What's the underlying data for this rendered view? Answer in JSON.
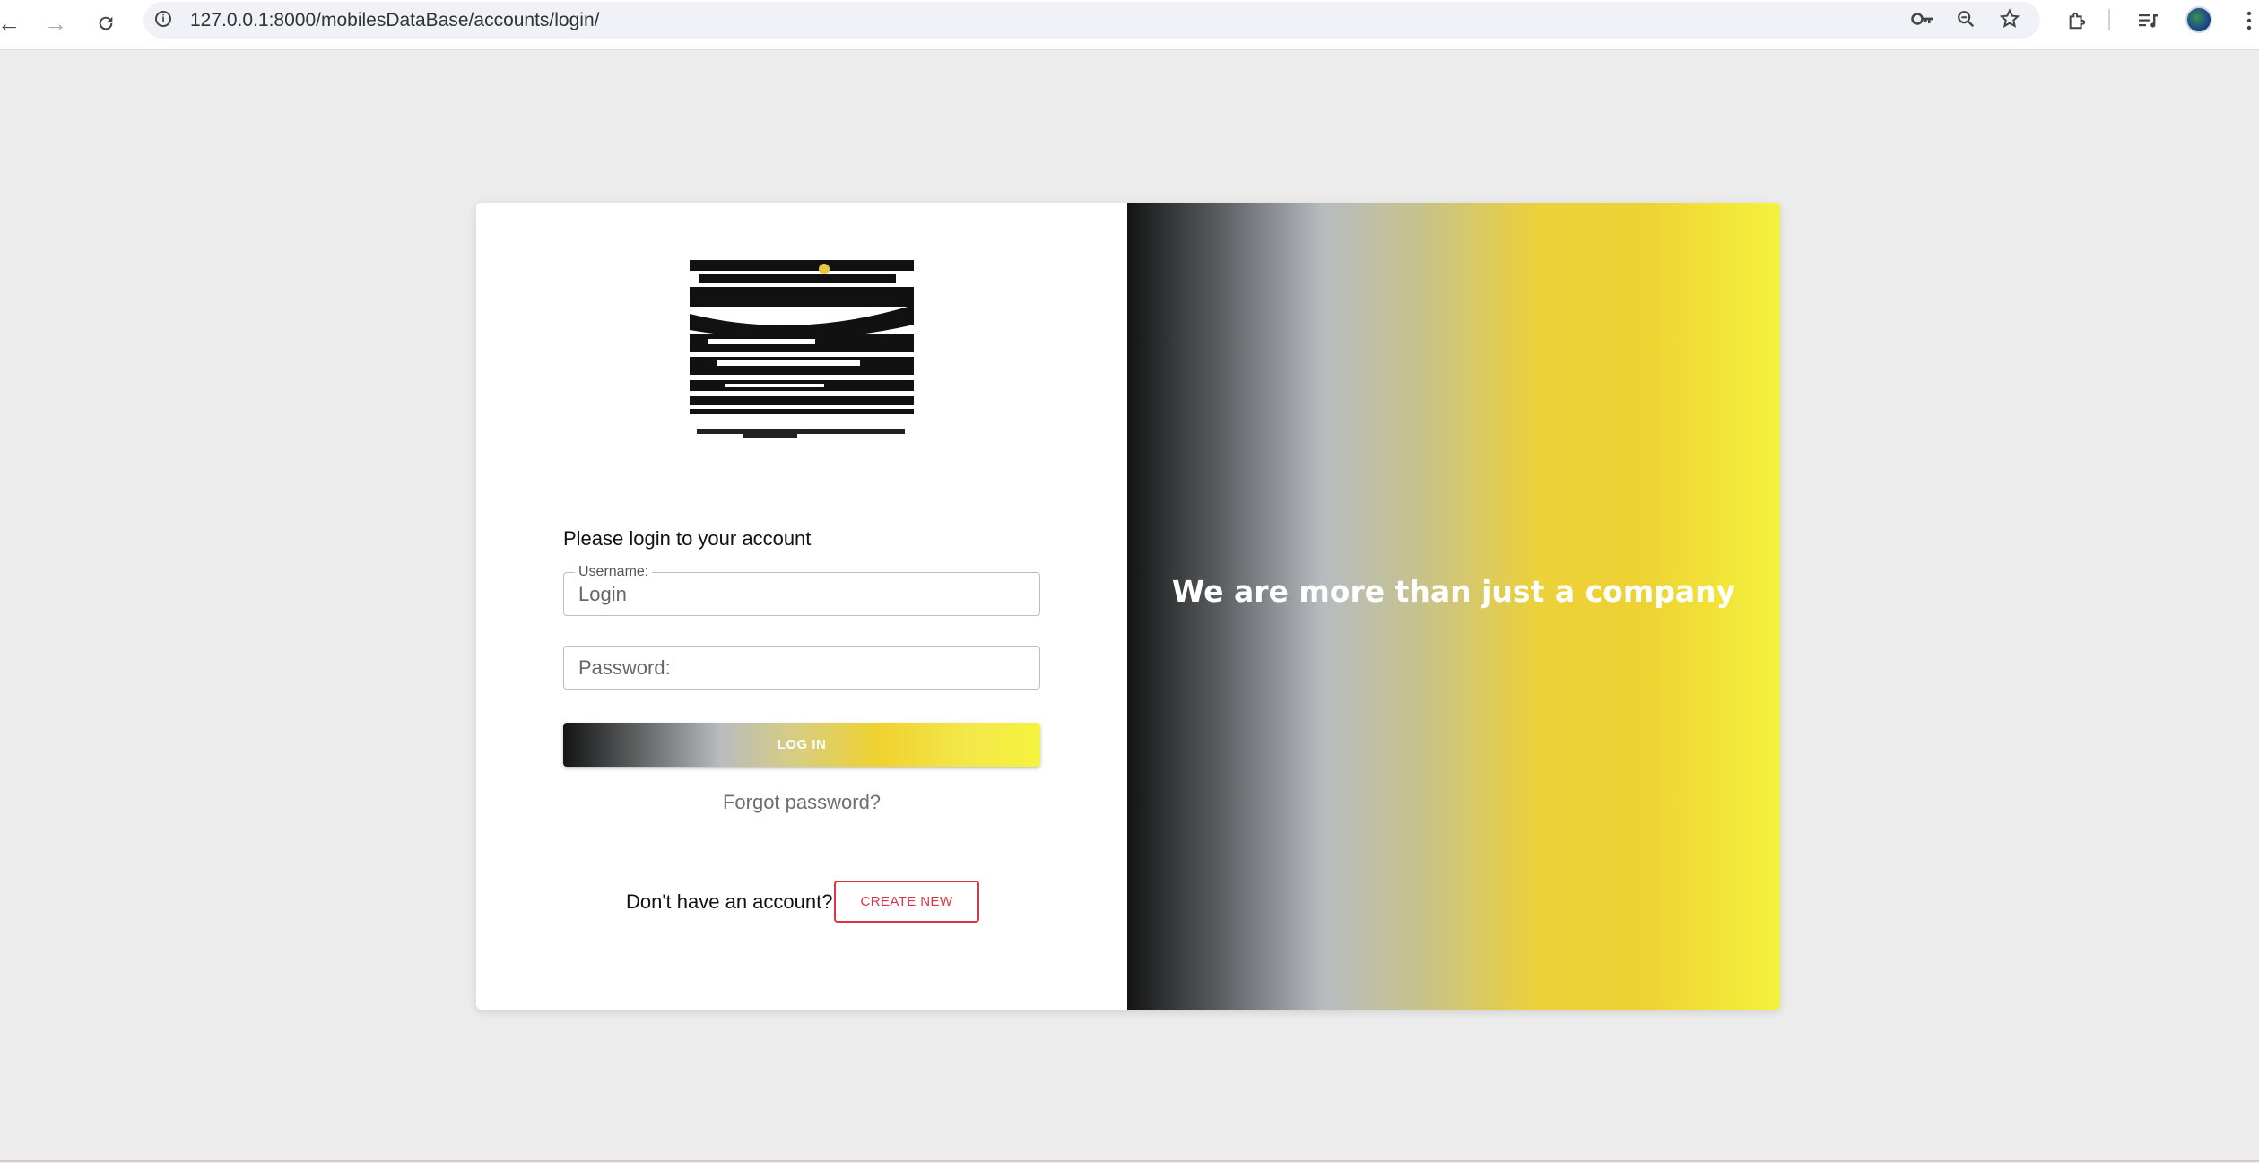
{
  "browser": {
    "url": "127.0.0.1:8000/mobilesDataBase/accounts/login/",
    "back_icon": "arrow-left-icon",
    "forward_icon": "arrow-right-icon",
    "reload_icon": "reload-icon"
  },
  "login": {
    "prompt": "Please login to your account",
    "username_label": "Username:",
    "username_placeholder": "Login",
    "password_placeholder": "Password:",
    "login_button": "LOG IN",
    "forgot_password": "Forgot password?",
    "no_account_text": "Don't have an account?",
    "create_button": "CREATE NEW",
    "accent_color": "#dc3545"
  },
  "promo": {
    "tagline": "We are more than just a company"
  }
}
